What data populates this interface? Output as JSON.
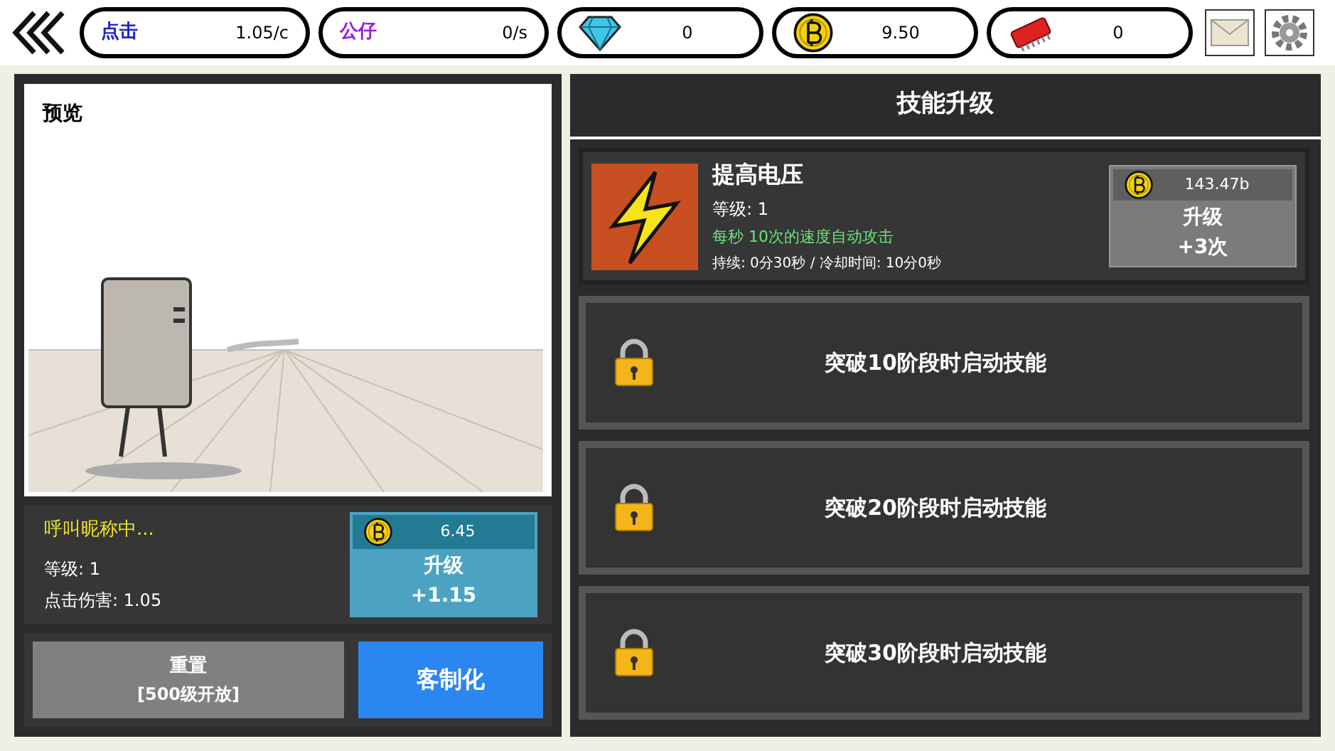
{
  "stats": [
    {
      "kind": "click",
      "label": "点击",
      "value": "1.05/c"
    },
    {
      "kind": "partner",
      "label": "公仔",
      "value": "0/s"
    },
    {
      "kind": "diamond",
      "value": "0"
    },
    {
      "kind": "coin",
      "value": "9.50"
    },
    {
      "kind": "chip",
      "value": "0"
    }
  ],
  "preview": {
    "title": "预览"
  },
  "hero": {
    "name": "呼叫昵称中...",
    "level": "等级: 1",
    "damage": "点击伤害: 1.05",
    "upgrade": {
      "cost": "6.45",
      "label": "升级",
      "gain": "+1.15"
    }
  },
  "actions": {
    "reset": {
      "label": "重置",
      "note": "[500级开放]"
    },
    "customize": "客制化"
  },
  "skills": {
    "title": "技能升级",
    "items": [
      {
        "kind": "unlocked",
        "name": "提高电压",
        "level": "等级: 1",
        "effect": "每秒 10次的速度自动攻击",
        "duration": "持续: 0分30秒 / 冷却时间: 10分0秒",
        "upgrade": {
          "cost": "143.47b",
          "label": "升级",
          "gain": "+3次"
        }
      },
      {
        "kind": "locked",
        "label": "突破10阶段时启动技能"
      },
      {
        "kind": "locked",
        "label": "突破20阶段时启动技能"
      },
      {
        "kind": "locked",
        "label": "突破30阶段时启动技能"
      }
    ]
  }
}
